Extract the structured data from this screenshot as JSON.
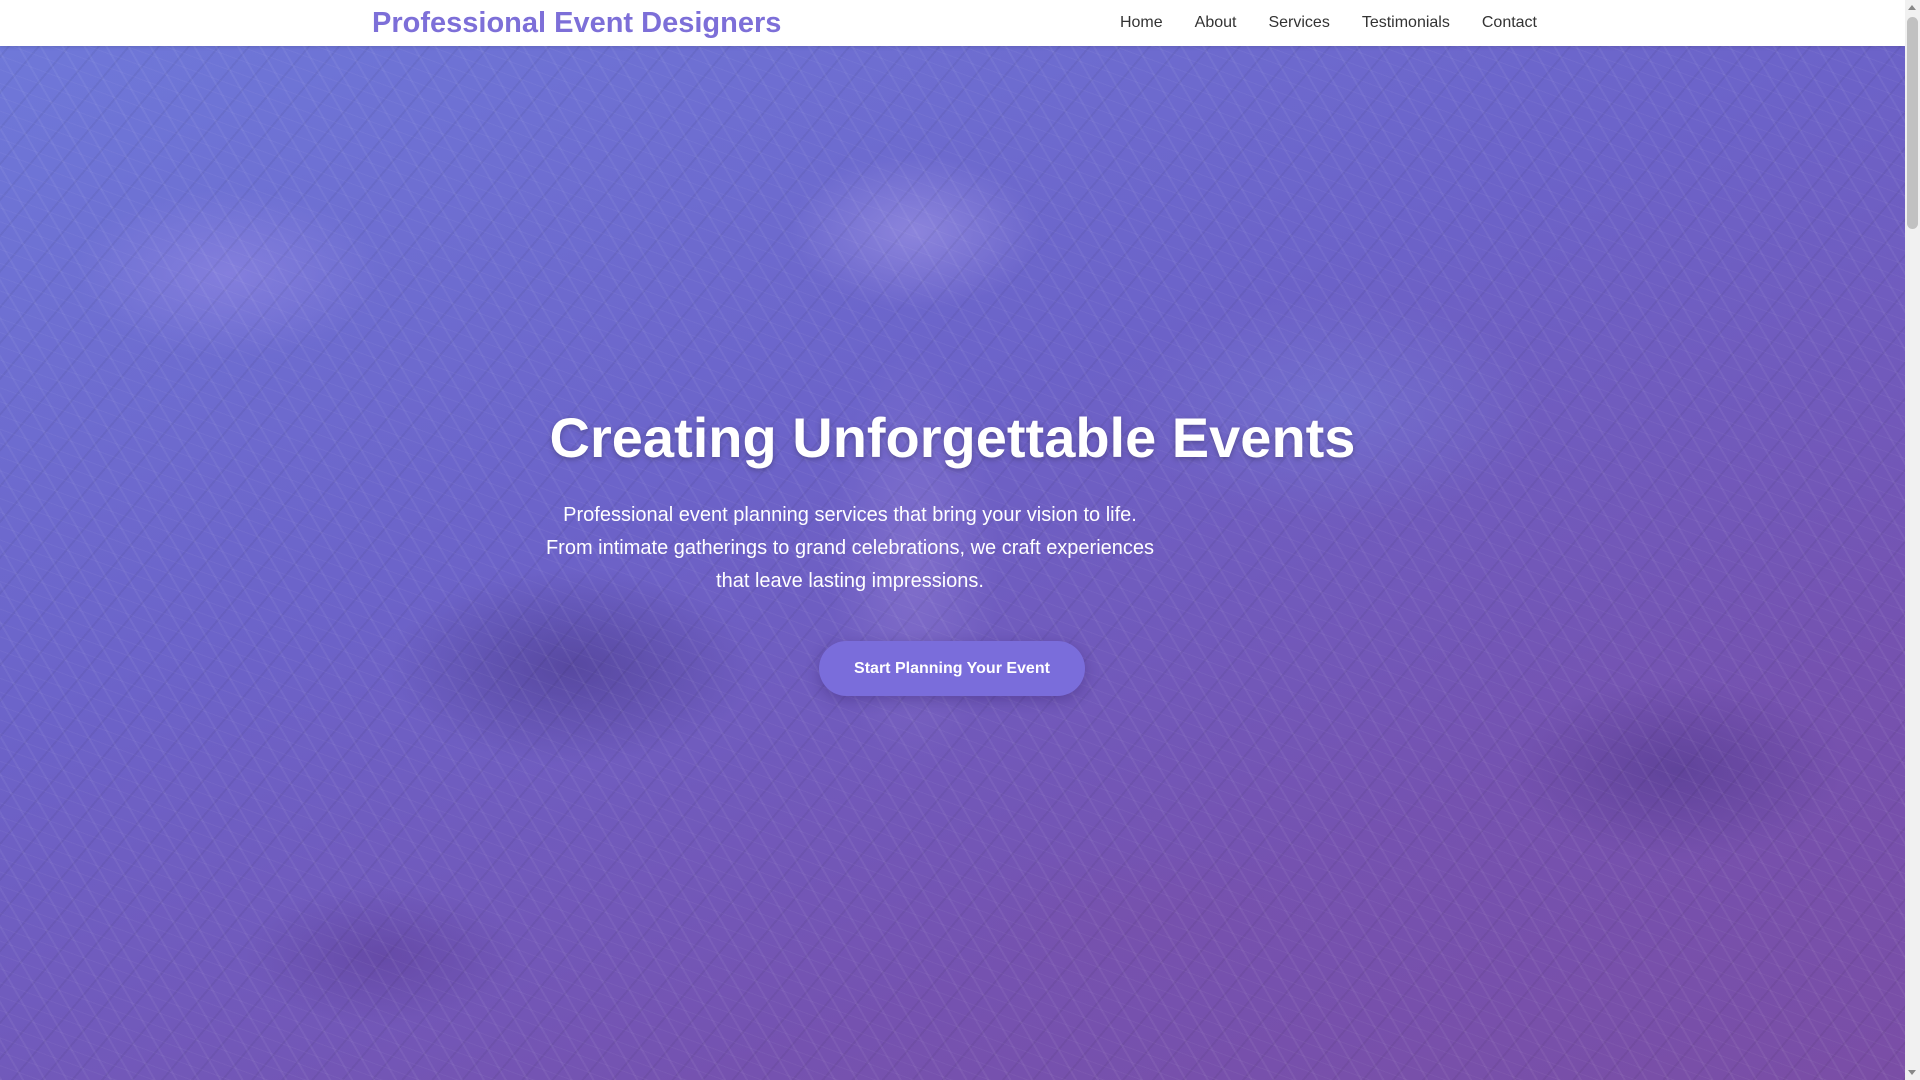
{
  "header": {
    "brand": "Professional Event Designers",
    "nav": [
      "Home",
      "About",
      "Services",
      "Testimonials",
      "Contact"
    ]
  },
  "hero": {
    "title": "Creating Unforgettable Events",
    "subtitle": "Professional event planning services that bring your vision to life. From intimate gatherings to grand celebrations, we craft experiences that leave lasting impressions.",
    "cta_label": "Start Planning Your Event",
    "background": "purple-tinted photo of leaves, grass and soil"
  },
  "colors": {
    "brand": "#7d6fd8",
    "overlay": "#6c63c9",
    "cta": "#7a6ddb",
    "nav_text": "#333333"
  }
}
